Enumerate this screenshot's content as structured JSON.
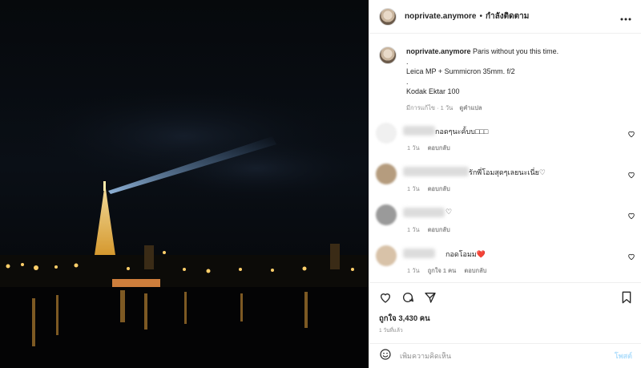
{
  "header": {
    "username": "noprivate.anymore",
    "separator": "•",
    "following": "กำลังติดตาม",
    "more": "···"
  },
  "caption": {
    "username": "noprivate.anymore",
    "line1": "Paris without you this time.",
    "line2": ".",
    "line3": "Leica MP + Summicron 35mm. f/2",
    "line4": ".",
    "line5": "Kodak Ektar 100",
    "edited": "มีการแก้ไข · 1 วัน",
    "see_translation": "ดูคำแปล"
  },
  "comments": [
    {
      "text": "กอดๆนะคั้บบ□□□",
      "time": "1 วัน",
      "reply": "ตอบกลับ",
      "likes": ""
    },
    {
      "text": "รักพี่โอมสุดๆเลยนะเนี่ย♡",
      "time": "1 วัน",
      "reply": "ตอบกลับ",
      "likes": ""
    },
    {
      "text": "♡",
      "time": "1 วัน",
      "reply": "ตอบกลับ",
      "likes": ""
    },
    {
      "text": "กอดโอมม❤️",
      "time": "1 วัน",
      "reply": "ตอบกลับ",
      "likes": "ถูกใจ 1 คน"
    }
  ],
  "likes": "ถูกใจ 3,430 คน",
  "posted": "1 วันที่แล้ว",
  "add_comment": {
    "placeholder": "เพิ่มความคิดเห็น",
    "post": "โพสต์"
  },
  "icons": [
    "more-icon",
    "heart-icon",
    "comment-icon",
    "share-icon",
    "bookmark-icon",
    "emoji-icon"
  ],
  "colors": {
    "post_button": "#b2dffc",
    "heart_red": "#ed4956",
    "meta_gray": "#8e8e8e"
  }
}
